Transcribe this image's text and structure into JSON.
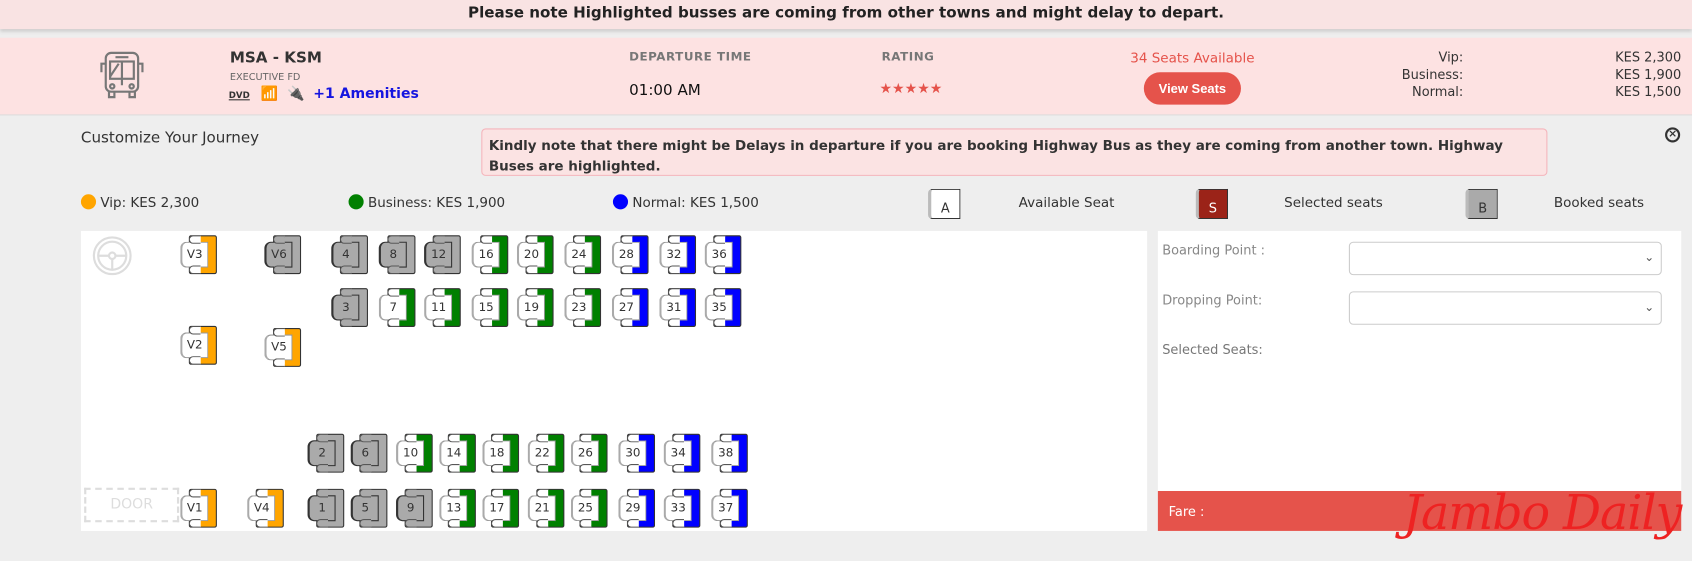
{
  "notice": "Please note Highlighted busses are coming from other towns and might delay to depart.",
  "bus": {
    "route": "MSA - KSM",
    "class": "EXECUTIVE FD",
    "amenities": [
      "dvd-icon",
      "wifi-icon",
      "charging-plug-icon"
    ],
    "more_amenities": "+1 Amenities",
    "departure_label": "DEPARTURE TIME",
    "departure": "01:00 AM",
    "rating_label": "RATING",
    "rating": 5,
    "stars": "★★★★★",
    "seats_available": "34 Seats Available",
    "view_seats": "View Seats",
    "prices": [
      {
        "label": "Vip:",
        "value": "KES 2,300"
      },
      {
        "label": "Business:",
        "value": "KES 1,900"
      },
      {
        "label": "Normal:",
        "value": "KES 1,500"
      }
    ]
  },
  "customize": {
    "title": "Customize Your Journey",
    "alert": "Kindly note that there might be Delays in departure if you are booking Highway Bus as they are coming from another town. Highway Buses are highlighted."
  },
  "legend": {
    "classes": [
      {
        "label": "Vip: KES 2,300",
        "color": "#ffa500"
      },
      {
        "label": "Business: KES 1,900",
        "color": "#008000"
      },
      {
        "label": "Normal: KES 1,500",
        "color": "#0000ff"
      }
    ],
    "status": [
      {
        "letter": "A",
        "label": "Available Seat"
      },
      {
        "letter": "S",
        "label": "Selected seats",
        "color": "#9b2318"
      },
      {
        "letter": "B",
        "label": "Booked seats",
        "color": "#aaaaaa"
      }
    ]
  },
  "colors": {
    "vip": "#ffa500",
    "business": "#008000",
    "normal": "#0000ff",
    "booked": "#aaaaaa",
    "accent": "#e5534b"
  },
  "door": "DOOR",
  "seats": [
    {
      "l": "V3",
      "c": "vip"
    },
    {
      "l": "V6",
      "c": "booked"
    },
    {
      "l": "4",
      "c": "booked"
    },
    {
      "l": "8",
      "c": "booked"
    },
    {
      "l": "12",
      "c": "booked"
    },
    {
      "l": "16",
      "c": "business"
    },
    {
      "l": "20",
      "c": "business"
    },
    {
      "l": "24",
      "c": "business"
    },
    {
      "l": "28",
      "c": "normal"
    },
    {
      "l": "32",
      "c": "normal"
    },
    {
      "l": "36",
      "c": "normal"
    },
    {
      "l": "3",
      "c": "booked"
    },
    {
      "l": "7",
      "c": "business"
    },
    {
      "l": "11",
      "c": "business"
    },
    {
      "l": "15",
      "c": "business"
    },
    {
      "l": "19",
      "c": "business"
    },
    {
      "l": "23",
      "c": "business"
    },
    {
      "l": "27",
      "c": "normal"
    },
    {
      "l": "31",
      "c": "normal"
    },
    {
      "l": "35",
      "c": "normal"
    },
    {
      "l": "V2",
      "c": "vip"
    },
    {
      "l": "V5",
      "c": "vip"
    },
    {
      "l": "2",
      "c": "booked"
    },
    {
      "l": "6",
      "c": "booked"
    },
    {
      "l": "10",
      "c": "business"
    },
    {
      "l": "14",
      "c": "business"
    },
    {
      "l": "18",
      "c": "business"
    },
    {
      "l": "22",
      "c": "business"
    },
    {
      "l": "26",
      "c": "business"
    },
    {
      "l": "30",
      "c": "normal"
    },
    {
      "l": "34",
      "c": "normal"
    },
    {
      "l": "38",
      "c": "normal"
    },
    {
      "l": "V1",
      "c": "vip"
    },
    {
      "l": "V4",
      "c": "vip"
    },
    {
      "l": "1",
      "c": "booked"
    },
    {
      "l": "5",
      "c": "booked"
    },
    {
      "l": "9",
      "c": "booked"
    },
    {
      "l": "13",
      "c": "business"
    },
    {
      "l": "17",
      "c": "business"
    },
    {
      "l": "21",
      "c": "business"
    },
    {
      "l": "25",
      "c": "business"
    },
    {
      "l": "29",
      "c": "normal"
    },
    {
      "l": "33",
      "c": "normal"
    },
    {
      "l": "37",
      "c": "normal"
    }
  ],
  "side": {
    "boarding": "Boarding Point :",
    "dropping": "Dropping Point:",
    "selected": "Selected Seats:",
    "fare": "Fare :"
  },
  "watermark": "Jambo Daily"
}
